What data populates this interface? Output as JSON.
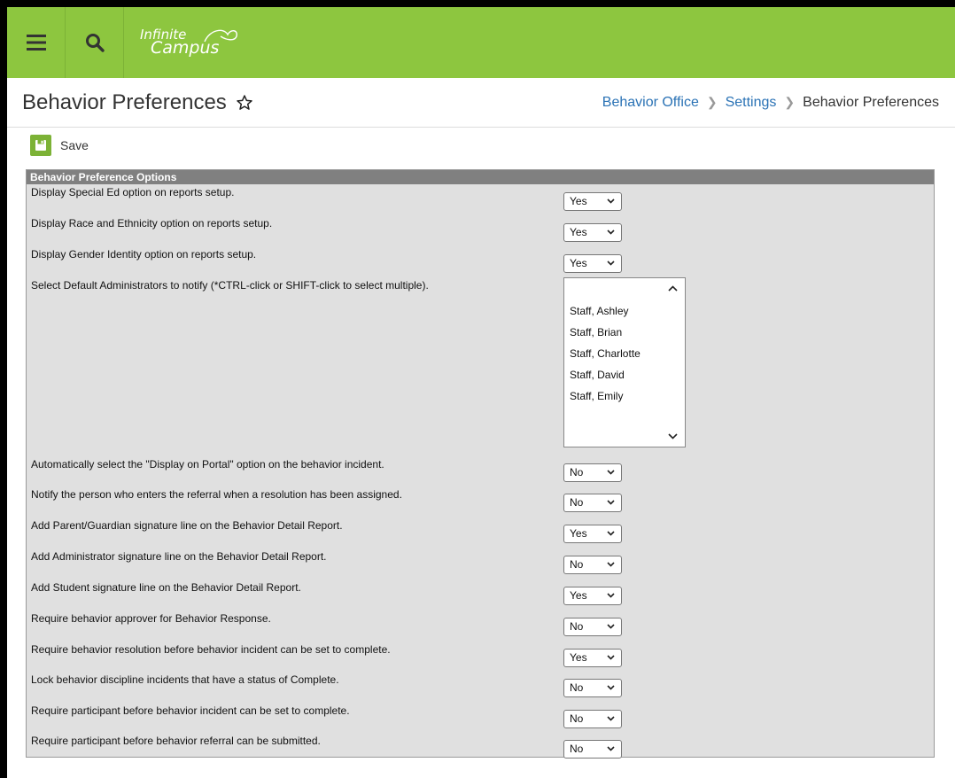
{
  "app": {
    "logo_line1": "Infinite",
    "logo_line2": "Campus"
  },
  "header": {
    "title": "Behavior Preferences",
    "breadcrumb": [
      "Behavior Office",
      "Settings",
      "Behavior Preferences"
    ]
  },
  "toolbar": {
    "save_label": "Save"
  },
  "panel": {
    "title": "Behavior Preference Options",
    "rows": [
      {
        "label": "Display Special Ed option on reports setup.",
        "value": "Yes"
      },
      {
        "label": "Display Race and Ethnicity option on reports setup.",
        "value": "Yes"
      },
      {
        "label": "Display Gender Identity option on reports setup.",
        "value": "Yes"
      },
      {
        "label": "Select Default Administrators to notify (*CTRL-click or SHIFT-click to select multiple).",
        "options": [
          "Staff, Ashley",
          "Staff, Brian",
          "Staff, Charlotte",
          "Staff, David",
          "Staff, Emily"
        ]
      },
      {
        "label": "Automatically select the \"Display on Portal\" option on the behavior incident.",
        "value": "No"
      },
      {
        "label": "Notify the person who enters the referral when a resolution has been assigned.",
        "value": "No"
      },
      {
        "label": "Add Parent/Guardian signature line on the Behavior Detail Report.",
        "value": "Yes"
      },
      {
        "label": "Add Administrator signature line on the Behavior Detail Report.",
        "value": "No"
      },
      {
        "label": "Add Student signature line on the Behavior Detail Report.",
        "value": "Yes"
      },
      {
        "label": "Require behavior approver for Behavior Response.",
        "value": "No"
      },
      {
        "label": "Require behavior resolution before behavior incident can be set to complete.",
        "value": "Yes"
      },
      {
        "label": "Lock behavior discipline incidents that have a status of Complete.",
        "value": "No"
      },
      {
        "label": "Require participant before behavior incident can be set to complete.",
        "value": "No"
      },
      {
        "label": "Require participant before behavior referral can be submitted.",
        "value": "No"
      }
    ]
  },
  "colors": {
    "topbar": "#8dc63f",
    "link": "#2a72b5",
    "panel_header": "#808080",
    "panel_bg": "#e0e0e0"
  },
  "icons": [
    "menu-icon",
    "search-icon",
    "star-icon",
    "save-icon",
    "chevron-down-icon"
  ]
}
